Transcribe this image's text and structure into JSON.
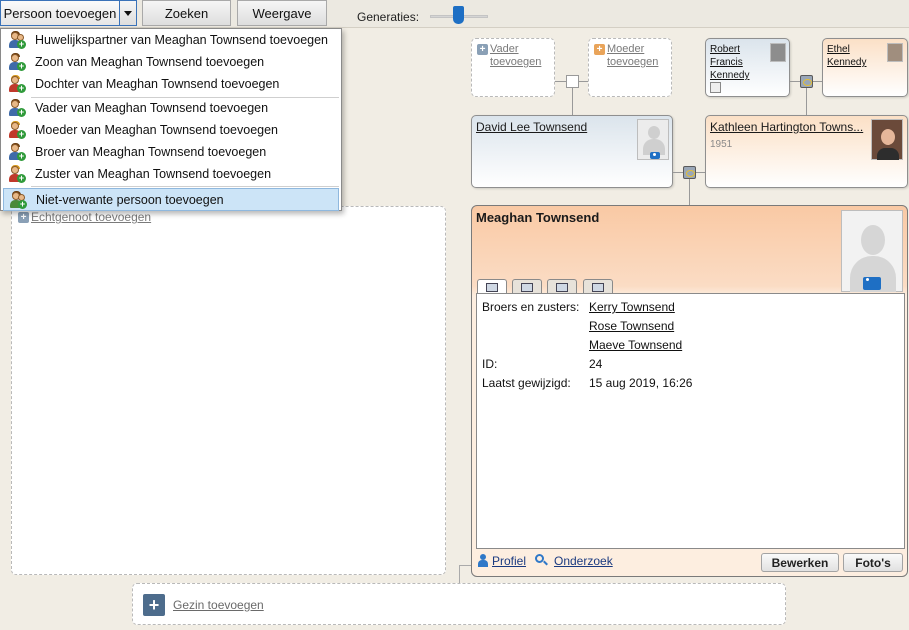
{
  "toolbar": {
    "add_person_label": "Persoon toevoegen",
    "search_label": "Zoeken",
    "view_label": "Weergave",
    "generations_label": "Generaties:",
    "generations_level": 0.45
  },
  "add_menu": {
    "items": [
      {
        "label": "Huwelijkspartner van Meaghan Townsend toevoegen",
        "icon": "add-partner-icon"
      },
      {
        "label": "Zoon van Meaghan Townsend toevoegen",
        "icon": "add-son-icon"
      },
      {
        "label": "Dochter van Meaghan Townsend toevoegen",
        "icon": "add-daughter-icon"
      },
      {
        "label": "Vader van Meaghan Townsend toevoegen",
        "icon": "add-father-icon"
      },
      {
        "label": "Moeder van Meaghan Townsend toevoegen",
        "icon": "add-mother-icon"
      },
      {
        "label": "Broer van Meaghan Townsend toevoegen",
        "icon": "add-brother-icon"
      },
      {
        "label": "Zuster van Meaghan Townsend toevoegen",
        "icon": "add-sister-icon"
      },
      {
        "label": "Niet-verwante persoon toevoegen",
        "icon": "add-unrelated-person-icon",
        "selected": true
      }
    ]
  },
  "left_panel": {
    "spouse_link": "Echtgenoot toevoegen"
  },
  "tree": {
    "add_father": "Vader toevoegen",
    "add_mother": "Moeder toevoegen",
    "grandfather": "Robert Francis Kennedy",
    "grandmother": "Ethel Kennedy",
    "father": "David Lee Townsend",
    "mother": "Kathleen Hartington Towns...",
    "mother_year": "1951"
  },
  "main_person": {
    "name": "Meaghan Townsend",
    "siblings_label": "Broers en zusters:",
    "siblings": [
      "Kerry Townsend",
      "Rose Townsend",
      "Maeve Townsend"
    ],
    "id_label": "ID:",
    "id_value": "24",
    "modified_label": "Laatst gewijzigd:",
    "modified_value": "15 aug 2019, 16:26",
    "profile_link": "Profiel",
    "research_link": "Onderzoek",
    "edit_button": "Bewerken",
    "photos_button": "Foto's"
  },
  "family": {
    "add_family": "Gezin toevoegen"
  }
}
